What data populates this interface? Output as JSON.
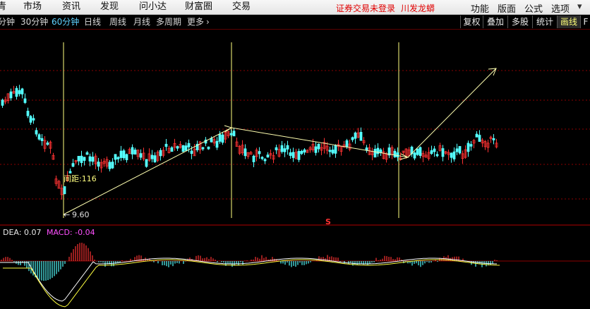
{
  "menu": {
    "items": [
      "青",
      "市场",
      "资讯",
      "发现",
      "问小达",
      "财富圈",
      "交易"
    ],
    "notice": "证券交易未登录",
    "stock_name": "川发龙蟒",
    "right_items": [
      "功能",
      "版面",
      "公式",
      "选项"
    ]
  },
  "toolbar": {
    "periods": [
      "分钟",
      "30分钟",
      "60分钟",
      "日线",
      "周线",
      "月线",
      "多周期",
      "更多"
    ],
    "active_period": "60分钟",
    "more_arrow": "›",
    "buttons": [
      "复权",
      "叠加",
      "多股",
      "统计",
      "画线",
      "F"
    ],
    "active_button": "画线"
  },
  "chart": {
    "distance_label": "间距:116",
    "low_price_label": "9.60",
    "low_price_arrow": "←",
    "marker_symbol": "S",
    "colors": {
      "up": "#ff3232",
      "down": "#54ffff",
      "vline": "#ffff80",
      "drawline": "#ffffb0",
      "grid": "#8b0000"
    }
  },
  "macd": {
    "dea_label": "DEA: 0.07",
    "macd_label": "MACD: -0.04"
  }
}
